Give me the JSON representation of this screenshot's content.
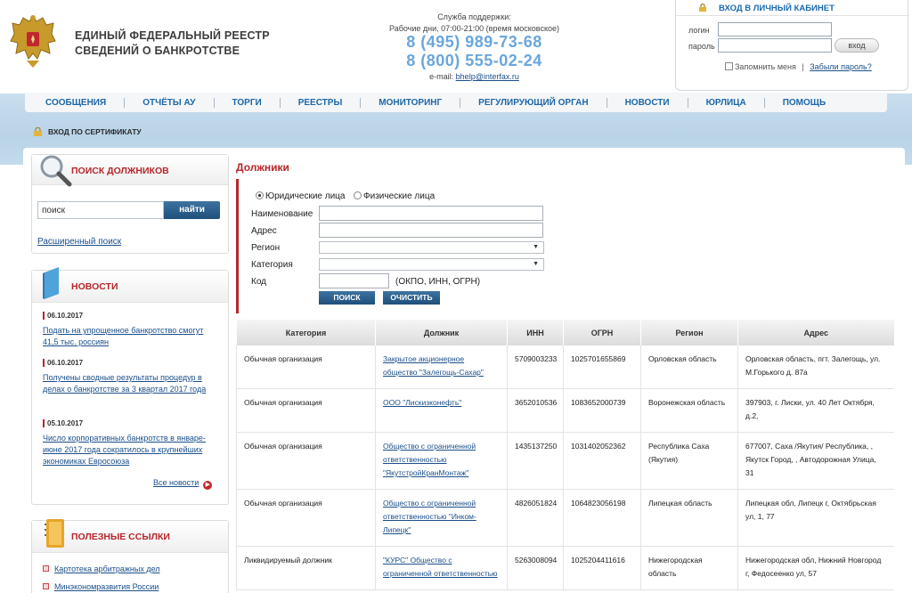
{
  "brand": {
    "line1": "ЕДИНЫЙ ФЕДЕРАЛЬНЫЙ РЕЕСТР",
    "line2": "СВЕДЕНИЙ О БАНКРОТСТВЕ"
  },
  "support": {
    "title": "Служба поддержки:",
    "hours": "Рабочие дни, 07:00-21:00 (время московское)",
    "phone1": "8 (495) 989-73-68",
    "phone2": "8 (800) 555-02-24",
    "email_label": "e-mail:",
    "email": "bhelp@interfax.ru"
  },
  "cabinet": {
    "title": "ВХОД В ЛИЧНЫЙ КАБИНЕТ",
    "login_label": "логин",
    "password_label": "пароль",
    "login_button": "вход",
    "remember": "Запомнить меня",
    "separator": "|",
    "forgot": "Забыли пароль?"
  },
  "nav": [
    "СООБЩЕНИЯ",
    "ОТЧЁТЫ АУ",
    "ТОРГИ",
    "РЕЕСТРЫ",
    "МОНИТОРИНГ",
    "РЕГУЛИРУЮЩИЙ ОРГАН",
    "НОВОСТИ",
    "ЮРЛИЦА",
    "ПОМОЩЬ"
  ],
  "cert_login": "ВХОД ПО СЕРТИФИКАТУ",
  "search_panel": {
    "title": "ПОИСК ДОЛЖНИКОВ",
    "placeholder": "поиск",
    "button": "найти",
    "advanced": "Расширенный поиск"
  },
  "news_panel": {
    "title": "НОВОСТИ",
    "items": [
      {
        "date": "06.10.2017",
        "text": "Подать на упрощенное банкротство смогут 41,5 тыс. россиян"
      },
      {
        "date": "06.10.2017",
        "text": "Получены сводные результаты процедур в делах о банкротстве за 3 квартал 2017 года"
      },
      {
        "date": "05.10.2017",
        "text": "Число корпоративных банкротств в январе-июне 2017 года сократилось в крупнейших экономиках Евросоюза"
      }
    ],
    "all": "Все новости"
  },
  "links_panel": {
    "title": "ПОЛЕЗНЫЕ ССЫЛКИ",
    "items": [
      "Картотека арбитражных дел",
      "Минэкономразвития России"
    ]
  },
  "main": {
    "title": "Должники",
    "radio_legal": "Юридические лица",
    "radio_person": "Физические лица",
    "name_label": "Наименование",
    "address_label": "Адрес",
    "region_label": "Регион",
    "category_label": "Категория",
    "code_label": "Код",
    "code_hint": "(ОКПО, ИНН, ОГРН)",
    "search_button": "ПОИСК",
    "clear_button": "ОЧИСТИТЬ"
  },
  "table": {
    "headers": [
      "Категория",
      "Должник",
      "ИНН",
      "ОГРН",
      "Регион",
      "Адрес"
    ],
    "rows": [
      {
        "category": "Обычная организация",
        "debtor": "Закрытое акционерное общество \"Залегощь-Сахар\"",
        "inn": "5709003233",
        "ogrn": "1025701655869",
        "region": "Орловская область",
        "address": "Орловская область, пгт. Залегощь, ул. М.Горького д. 87а"
      },
      {
        "category": "Обычная организация",
        "debtor": "ООО \"Лискизконефть\"",
        "inn": "3652010536",
        "ogrn": "1083652000739",
        "region": "Воронежская область",
        "address": "397903, г. Лиски, ул. 40 Лет Октября, д.2,"
      },
      {
        "category": "Обычная организация",
        "debtor": "Общество с ограниченной ответственностью \"ЯкутстройКранМонтаж\"",
        "inn": "1435137250",
        "ogrn": "1031402052362",
        "region": "Республика Саха (Якутия)",
        "address": "677007, Саха /Якутия/ Республика, , Якутск Город, , Автодорожная Улица, 31"
      },
      {
        "category": "Обычная организация",
        "debtor": "Общество с ограниченной ответственностью \"Инком-Липецк\"",
        "inn": "4826051824",
        "ogrn": "1064823056198",
        "region": "Липецкая область",
        "address": "Липецкая обл, Липецк г, Октябрьская ул, 1, 77"
      },
      {
        "category": "Ликвидируемый должник",
        "debtor": "\"КУРС\" Общество с ограниченной ответственностью",
        "inn": "5263008094",
        "ogrn": "1025204411616",
        "region": "Нижегородская область",
        "address": "Нижегородская обл, Нижний Новгород г, Федосеенко ул, 57"
      }
    ]
  },
  "colors": {
    "accent_red": "#b5262b",
    "link_blue": "#1b4f8a",
    "phone_blue": "#6aa6dc",
    "nav_blue": "#1d67a8",
    "button_blue": "#1e4f7a"
  }
}
